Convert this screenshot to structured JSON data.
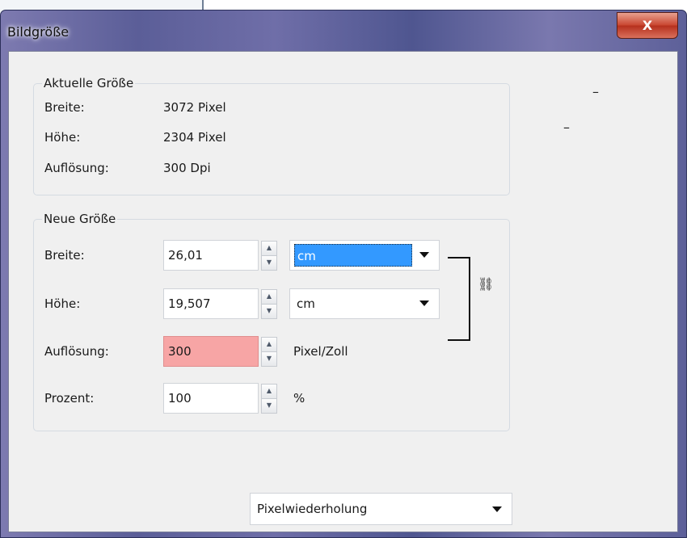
{
  "dialog": {
    "title": "Bildgröße",
    "close_label": "X"
  },
  "aktuelle_groesse": {
    "legend": "Aktuelle Größe",
    "rows": [
      {
        "label": "Breite:",
        "value": "3072 Pixel"
      },
      {
        "label": "Höhe:",
        "value": "2304 Pixel"
      },
      {
        "label": "Auflösung:",
        "value": "300 Dpi"
      }
    ]
  },
  "neue_groesse": {
    "legend": "Neue Größe",
    "breite": {
      "label": "Breite:",
      "value": "26,01",
      "unit": "cm"
    },
    "hoehe": {
      "label": "Höhe:",
      "value": "19,507",
      "unit": "cm"
    },
    "aufloesung": {
      "label": "Auflösung:",
      "value": "300",
      "unit": "Pixel/Zoll"
    },
    "prozent": {
      "label": "Prozent:",
      "value": "100",
      "unit": "%"
    }
  },
  "side_marks": {
    "dash1": "–",
    "dash2": "–"
  },
  "resampling": {
    "selected": "Pixelwiederholung"
  },
  "icons": {
    "link": "chain-link-icon",
    "close": "close-icon"
  },
  "colors": {
    "selection": "#3399ff",
    "invalid_field": "#f7a5a5",
    "close_button": "#c9452f"
  }
}
